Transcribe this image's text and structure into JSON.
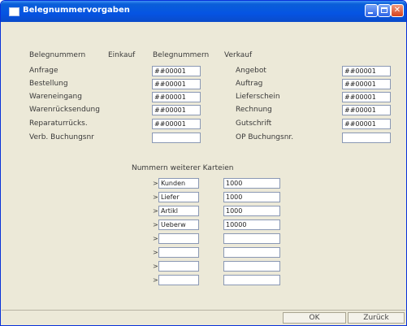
{
  "window": {
    "title": "Belegnummervorgaben"
  },
  "headers": {
    "col1": "Belegnummern",
    "col2": "Einkauf",
    "col3": "Belegnummern",
    "col4": "Verkauf"
  },
  "einkauf": [
    {
      "label": "Anfrage",
      "value": "##00001"
    },
    {
      "label": "Bestellung",
      "value": "##00001"
    },
    {
      "label": "Wareneingang",
      "value": "##00001"
    },
    {
      "label": "Warenrücksendung",
      "value": "##00001"
    },
    {
      "label": "Reparaturrücks.",
      "value": "##00001"
    },
    {
      "label": "Verb. Buchungsnr",
      "value": ""
    }
  ],
  "verkauf": [
    {
      "label": "Angebot",
      "value": "##00001"
    },
    {
      "label": "Auftrag",
      "value": "##00001"
    },
    {
      "label": "Lieferschein",
      "value": "##00001"
    },
    {
      "label": "Rechnung",
      "value": "##00001"
    },
    {
      "label": "Gutschrift",
      "value": "##00001"
    },
    {
      "label": "OP Buchungsnr.",
      "value": ""
    }
  ],
  "karteien": {
    "title": "Nummern weiterer Karteien",
    "prefix": ">",
    "rows": [
      {
        "name": "Kunden",
        "value": "1000"
      },
      {
        "name": "Liefer",
        "value": "1000"
      },
      {
        "name": "Artikl",
        "value": "1000"
      },
      {
        "name": "Ueberw",
        "value": "10000"
      },
      {
        "name": "",
        "value": ""
      },
      {
        "name": "",
        "value": ""
      },
      {
        "name": "",
        "value": ""
      },
      {
        "name": "",
        "value": ""
      }
    ]
  },
  "buttons": {
    "ok": "OK",
    "back": "Zurück"
  }
}
